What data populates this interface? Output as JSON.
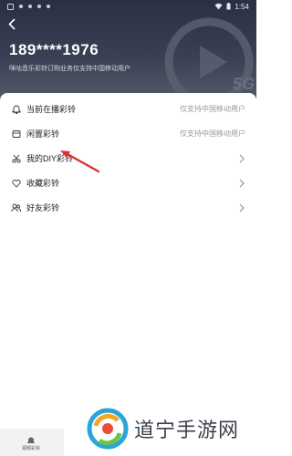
{
  "status_bar": {
    "time": "1:54"
  },
  "profile": {
    "phone": "189****1976",
    "description": "咪咕音乐彩铃订购业务仅支持中国移动用户"
  },
  "menu": [
    {
      "label": "当前在播彩铃",
      "right_text": "仅支持中国移动用户",
      "icon": "bell-icon"
    },
    {
      "label": "闲置彩铃",
      "right_text": "仅支持中国移动用户",
      "icon": "folder-icon"
    },
    {
      "label": "我的DIY彩铃",
      "right_text": "",
      "icon": "scissors-icon"
    },
    {
      "label": "收藏彩铃",
      "right_text": "",
      "icon": "heart-icon"
    },
    {
      "label": "好友彩铃",
      "right_text": "",
      "icon": "friends-icon"
    }
  ],
  "bottom_tab": {
    "label": "视频彩铃"
  },
  "watermark": {
    "text": "道宁手游网"
  },
  "colors": {
    "header_dark": "#2a3044",
    "arrow_red": "#d9342b",
    "text_gray": "#999999"
  }
}
